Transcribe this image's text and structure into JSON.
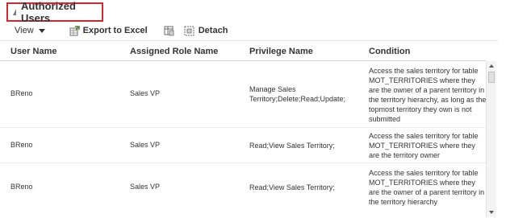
{
  "section": {
    "title": "Authorized Users"
  },
  "toolbar": {
    "view_label": "View",
    "export_label": "Export to Excel",
    "detach_label": "Detach"
  },
  "table": {
    "columns": [
      "User Name",
      "Assigned Role Name",
      "Privilege Name",
      "Condition"
    ],
    "rows": [
      {
        "user": "BReno",
        "role": "Sales VP",
        "privilege": "Manage Sales Territory;Delete;Read;Update;",
        "condition": "Access the sales territory for table MOT_TERRITORIES where they are the owner of a parent territory in the territory hierarchy, as long as the topmost territory they own is not submitted"
      },
      {
        "user": "BReno",
        "role": "Sales VP",
        "privilege": "Read;View Sales Territory;",
        "condition": "Access the sales territory for table MOT_TERRITORIES where they are the territory owner"
      },
      {
        "user": "BReno",
        "role": "Sales VP",
        "privilege": "Read;View Sales Territory;",
        "condition": "Access the sales territory for table MOT_TERRITORIES where they are the owner of a parent territory in the territory hierarchy"
      }
    ]
  },
  "icons": {
    "collapse": "collapse-triangle-icon",
    "view_menu": "chevron-down-icon",
    "export": "export-excel-icon",
    "freeze": "freeze-icon",
    "detach": "detach-icon"
  }
}
